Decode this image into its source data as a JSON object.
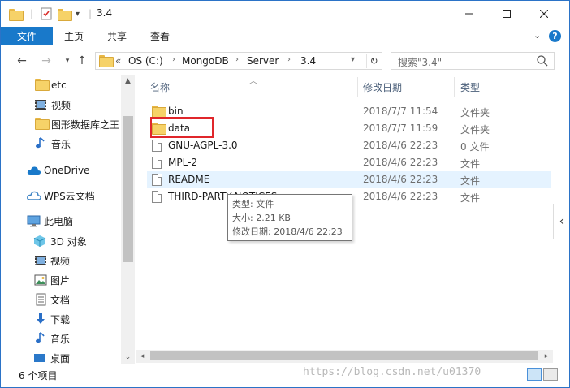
{
  "window": {
    "title": "3.4"
  },
  "ribbon": {
    "file": "文件",
    "tabs": [
      "主页",
      "共享",
      "查看"
    ],
    "help": "?"
  },
  "address": {
    "overflow": "«",
    "segments": [
      "OS (C:)",
      "MongoDB",
      "Server",
      "3.4"
    ]
  },
  "search": {
    "placeholder": "搜索\"3.4\""
  },
  "sidebar": {
    "quick": [
      {
        "label": "etc",
        "icon": "folder-icon"
      },
      {
        "label": "视频",
        "icon": "video-icon"
      },
      {
        "label": "图形数据库之王",
        "icon": "folder-icon"
      },
      {
        "label": "音乐",
        "icon": "music-icon"
      }
    ],
    "onedrive": "OneDrive",
    "wps": "WPS云文档",
    "thispc": "此电脑",
    "pc_items": [
      {
        "label": "3D 对象",
        "icon": "3d-objects-icon"
      },
      {
        "label": "视频",
        "icon": "video-icon"
      },
      {
        "label": "图片",
        "icon": "pictures-icon"
      },
      {
        "label": "文档",
        "icon": "documents-icon"
      },
      {
        "label": "下载",
        "icon": "download-icon"
      },
      {
        "label": "音乐",
        "icon": "music-icon"
      },
      {
        "label": "桌面",
        "icon": "desktop-icon"
      }
    ]
  },
  "columns": {
    "name": "名称",
    "date": "修改日期",
    "type": "类型"
  },
  "files": [
    {
      "name": "bin",
      "date": "2018/7/7 11:54",
      "type": "文件夹",
      "icon": "folder-icon"
    },
    {
      "name": "data",
      "date": "2018/7/7 11:59",
      "type": "文件夹",
      "icon": "folder-icon"
    },
    {
      "name": "GNU-AGPL-3.0",
      "date": "2018/4/6 22:23",
      "type": "0 文件",
      "icon": "file-icon"
    },
    {
      "name": "MPL-2",
      "date": "2018/4/6 22:23",
      "type": "文件",
      "icon": "file-icon"
    },
    {
      "name": "README",
      "date": "2018/4/6 22:23",
      "type": "文件",
      "icon": "file-icon"
    },
    {
      "name": "THIRD-PARTY-NOTICES",
      "date": "2018/4/6 22:23",
      "type": "文件",
      "icon": "file-icon"
    }
  ],
  "tooltip": {
    "type": "类型: 文件",
    "size": "大小: 2.21 KB",
    "modified": "修改日期: 2018/4/6 22:23"
  },
  "status": {
    "count": "6 个项目"
  },
  "watermark": "https://blog.csdn.net/u01370"
}
